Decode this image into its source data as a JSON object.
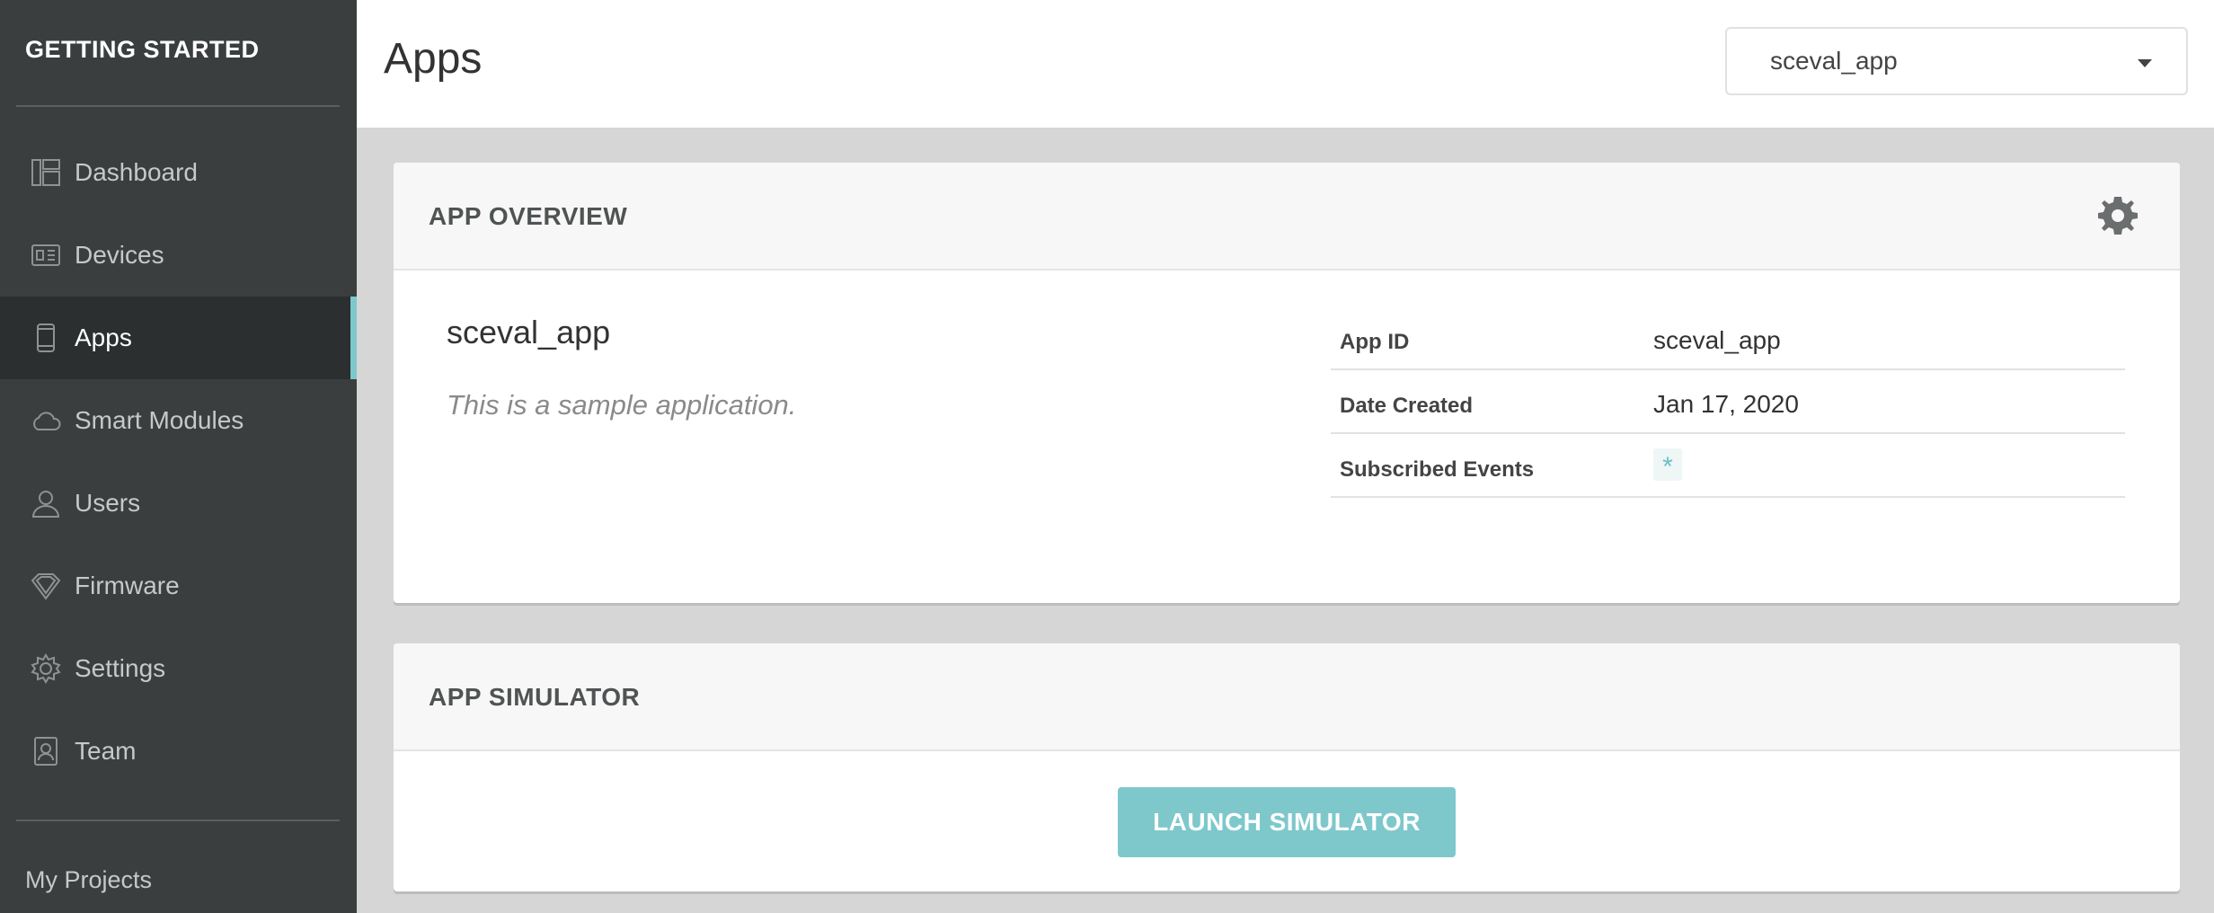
{
  "sidebar": {
    "title": "GETTING STARTED",
    "items": [
      {
        "label": "Dashboard",
        "icon": "dashboard-icon",
        "active": false
      },
      {
        "label": "Devices",
        "icon": "devices-icon",
        "active": false
      },
      {
        "label": "Apps",
        "icon": "apps-icon",
        "active": true
      },
      {
        "label": "Smart Modules",
        "icon": "cloud-icon",
        "active": false
      },
      {
        "label": "Users",
        "icon": "user-icon",
        "active": false
      },
      {
        "label": "Firmware",
        "icon": "firmware-icon",
        "active": false
      },
      {
        "label": "Settings",
        "icon": "gear-icon",
        "active": false
      },
      {
        "label": "Team",
        "icon": "team-icon",
        "active": false
      }
    ],
    "my_projects": "My Projects"
  },
  "header": {
    "title": "Apps",
    "app_select_value": "sceval_app"
  },
  "overview": {
    "title": "APP OVERVIEW",
    "app_name": "sceval_app",
    "description": "This is a sample application.",
    "details": [
      {
        "label": "App ID",
        "value": "sceval_app"
      },
      {
        "label": "Date Created",
        "value": "Jan 17, 2020"
      },
      {
        "label": "Subscribed Events",
        "value": "*"
      }
    ]
  },
  "simulator": {
    "title": "APP SIMULATOR",
    "launch_label": "LAUNCH SIMULATOR"
  },
  "colors": {
    "accent": "#7ec8cc",
    "sidebar_bg": "#3b3e3e",
    "sidebar_active_bg": "#2c2f2f"
  }
}
